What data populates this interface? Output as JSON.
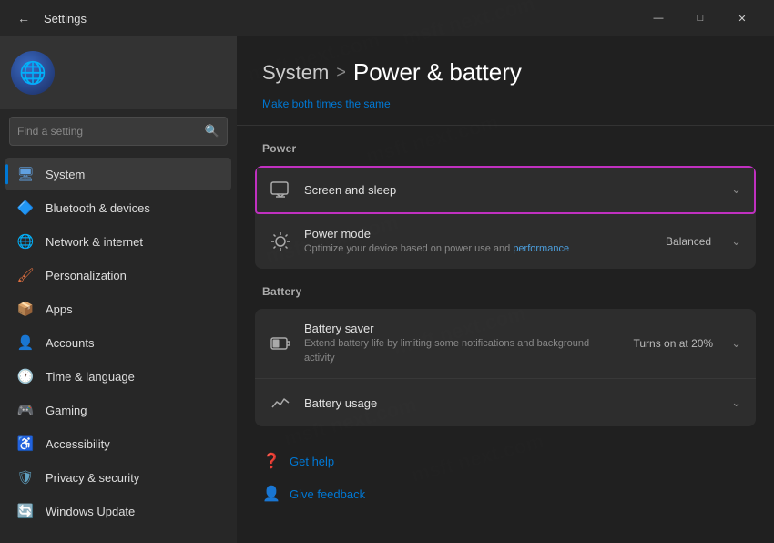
{
  "titlebar": {
    "title": "Settings",
    "back_label": "←",
    "minimize": "—",
    "maximize": "□",
    "close": "✕"
  },
  "sidebar": {
    "search_placeholder": "Find a setting",
    "nav_items": [
      {
        "id": "system",
        "label": "System",
        "icon": "🖥",
        "icon_class": "system",
        "active": true
      },
      {
        "id": "bluetooth",
        "label": "Bluetooth & devices",
        "icon": "🔷",
        "icon_class": "bluetooth",
        "active": false
      },
      {
        "id": "network",
        "label": "Network & internet",
        "icon": "🌐",
        "icon_class": "network",
        "active": false
      },
      {
        "id": "personalization",
        "label": "Personalization",
        "icon": "🖌",
        "icon_class": "personalization",
        "active": false
      },
      {
        "id": "apps",
        "label": "Apps",
        "icon": "📦",
        "icon_class": "apps",
        "active": false
      },
      {
        "id": "accounts",
        "label": "Accounts",
        "icon": "👤",
        "icon_class": "accounts",
        "active": false
      },
      {
        "id": "time",
        "label": "Time & language",
        "icon": "🕐",
        "icon_class": "time",
        "active": false
      },
      {
        "id": "gaming",
        "label": "Gaming",
        "icon": "🎮",
        "icon_class": "gaming",
        "active": false
      },
      {
        "id": "accessibility",
        "label": "Accessibility",
        "icon": "♿",
        "icon_class": "accessibility",
        "active": false
      },
      {
        "id": "privacy",
        "label": "Privacy & security",
        "icon": "🛡",
        "icon_class": "privacy",
        "active": false
      },
      {
        "id": "update",
        "label": "Windows Update",
        "icon": "🔄",
        "icon_class": "update",
        "active": false
      }
    ]
  },
  "main": {
    "breadcrumb_parent": "System",
    "breadcrumb_arrow": ">",
    "breadcrumb_current": "Power & battery",
    "hint_text": "Make both times the same",
    "sections": {
      "power_label": "Power",
      "battery_label": "Battery"
    },
    "power_items": [
      {
        "id": "screen-sleep",
        "title": "Screen and sleep",
        "icon": "🖥",
        "highlighted": true
      },
      {
        "id": "power-mode",
        "title": "Power mode",
        "desc": "Optimize your device based on power use and performance",
        "desc_link": "performance",
        "value": "Balanced",
        "icon": "⚡"
      }
    ],
    "battery_items": [
      {
        "id": "battery-saver",
        "title": "Battery saver",
        "desc": "Extend battery life by limiting some notifications and background activity",
        "value": "Turns on at 20%",
        "icon": "🔋"
      },
      {
        "id": "battery-usage",
        "title": "Battery usage",
        "icon": "📊"
      }
    ],
    "footer_links": [
      {
        "id": "get-help",
        "label": "Get help",
        "icon": "❓"
      },
      {
        "id": "give-feedback",
        "label": "Give feedback",
        "icon": "👤"
      }
    ]
  }
}
